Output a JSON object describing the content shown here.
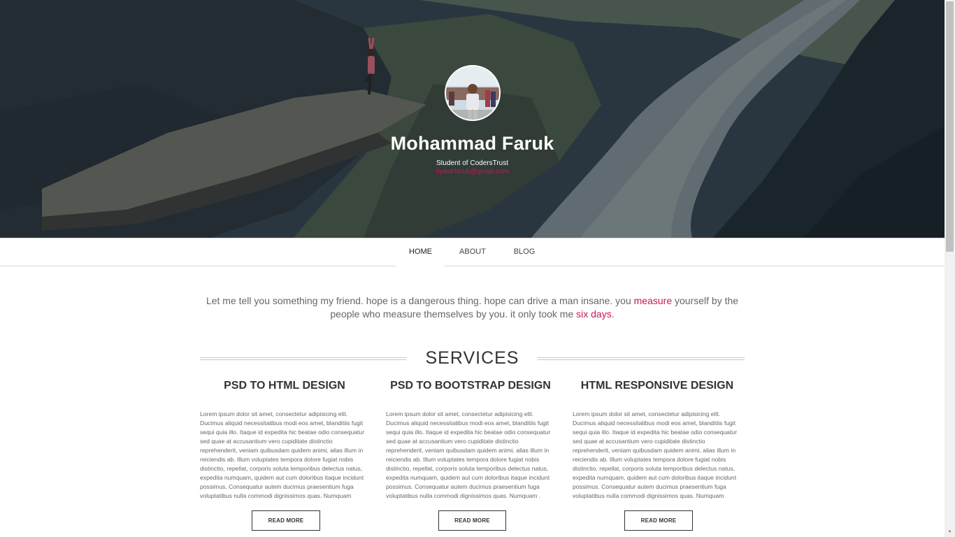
{
  "hero": {
    "name": "Mohammad Faruk",
    "role": "Student of CodersTrust",
    "email": "riyasirfaruk@gmail.com",
    "avatar_icon": "profile-photo"
  },
  "nav": {
    "items": [
      {
        "label": "HOME",
        "active": true
      },
      {
        "label": "ABOUT",
        "active": false
      },
      {
        "label": "BLOG",
        "active": false
      }
    ]
  },
  "quote": {
    "part1": "Let me tell you something my friend. hope is a dangerous thing. hope can drive a man insane. you ",
    "highlight1": "measure",
    "part2": " yourself by the people who measure themselves by you. it only took me ",
    "highlight2": "six days",
    "part3": "."
  },
  "services": {
    "title": "SERVICES",
    "items": [
      {
        "title": "PSD TO HTML DESIGN",
        "body": "Lorem ipsum dolor sit amet, consectetur adipisicing elit. Ducimus aliquid necessitatibus modi eos amet, blanditiis fugit sequi quia illo. Itaque id expedita hic beatae odio consequatur sed quae at accusantium vero cupiditate distinctio reprehenderit, veniam quibusdam quidem animi, alias illum in reiciendis ab. Illum voluptates tempora dolore fugiat nobis distinctio, repellat, corporis soluta temporibus delectus natus, expedita numquam, quidem aut cum doloribus itaque incidunt possimus. Consequatur autem ducimus praesentium fuga voluptatibus nulla commodi dignissimos quas. Numquam",
        "button": "READ MORE"
      },
      {
        "title": "PSD TO BOOTSTRAP DESIGN",
        "body": "Lorem ipsum dolor sit amet, consectetur adipisicing elit. Ducimus aliquid necessitatibus modi eos amet, blanditiis fugit sequi quia illo. Itaque id expedita hic beatae odio consequatur sed quae at accusantium vero cupiditate distinctio reprehenderit, veniam quibusdam quidem animi, alias illum in reiciendis ab. Illum voluptates tempora dolore fugiat nobis distinctio, repellat, corporis soluta temporibus delectus natus, expedita numquam, quidem aut cum doloribus itaque incidunt possimus. Consequatur autem ducimus praesentium fuga voluptatibus nulla commodi dignissimos quas. Numquam .",
        "button": "READ MORE"
      },
      {
        "title": "HTML RESPONSIVE DESIGN",
        "body": "Lorem ipsum dolor sit amet, consectetur adipisicing elit. Ducimus aliquid necessitatibus modi eos amet, blanditiis fugit sequi quia illo. Itaque id expedita hic beatae odio consequatur sed quae at accusantium vero cupiditate distinctio reprehenderit, veniam quibusdam quidem animi, alias illum in reiciendis ab. Illum voluptates tempora dolore fugiat nobis distinctio, repellat, corporis soluta temporibus delectus natus, expedita numquam, quidem aut cum doloribus itaque incidunt possimus. Consequatur autem ducimus praesentium fuga voluptatibus nulla commodi dignissimos quas. Numquam",
        "button": "READ MORE"
      }
    ]
  },
  "colors": {
    "accent": "#c2185b",
    "text": "#444444",
    "heading": "#333333"
  }
}
